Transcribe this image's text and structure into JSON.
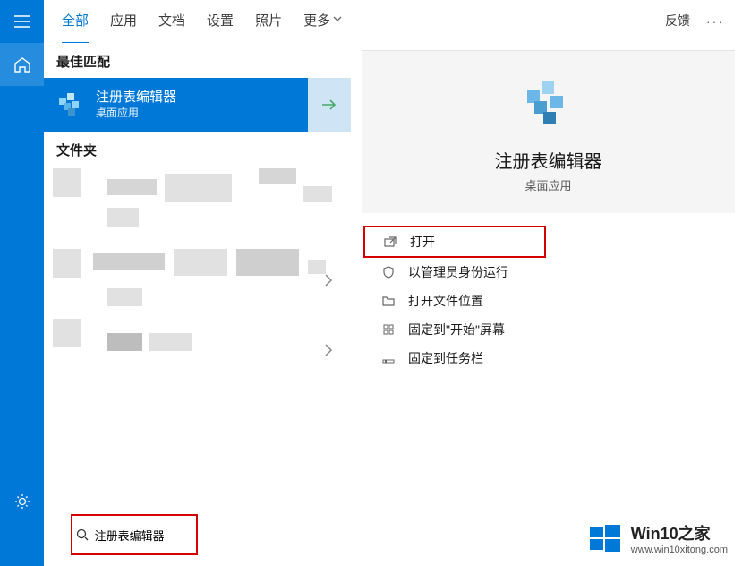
{
  "tabs": {
    "all": "全部",
    "apps": "应用",
    "docs": "文档",
    "settings": "设置",
    "photos": "照片",
    "more": "更多",
    "feedback": "反馈"
  },
  "sections": {
    "best_match": "最佳匹配",
    "folders": "文件夹"
  },
  "best_match": {
    "title": "注册表编辑器",
    "subtitle": "桌面应用"
  },
  "preview": {
    "title": "注册表编辑器",
    "subtitle": "桌面应用"
  },
  "actions": {
    "open": "打开",
    "run_admin": "以管理员身份运行",
    "open_location": "打开文件位置",
    "pin_start": "固定到\"开始\"屏幕",
    "pin_taskbar": "固定到任务栏"
  },
  "search": {
    "value": "注册表编辑器"
  },
  "watermark": {
    "title": "Win10之家",
    "url": "www.win10xitong.com"
  }
}
